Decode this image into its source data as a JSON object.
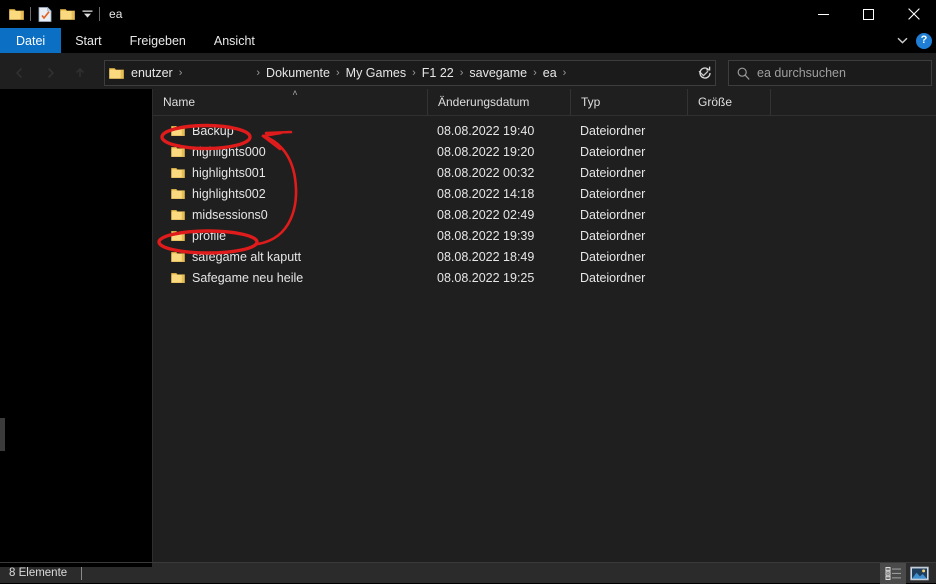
{
  "window": {
    "title": "ea",
    "quick_access": [
      {
        "icon": "folder-icon",
        "name": "quick-access-folder"
      },
      {
        "icon": "properties-icon",
        "name": "quick-access-properties"
      },
      {
        "icon": "new-folder-icon",
        "name": "quick-access-new-folder"
      }
    ],
    "controls": {
      "minimize": "minimize-icon",
      "maximize": "maximize-icon",
      "close": "close-icon"
    }
  },
  "ribbon": {
    "tabs": [
      {
        "label": "Datei",
        "active": true
      },
      {
        "label": "Start",
        "active": false
      },
      {
        "label": "Freigeben",
        "active": false
      },
      {
        "label": "Ansicht",
        "active": false
      }
    ],
    "expand_icon": "chevron-down-icon",
    "help_label": "?"
  },
  "address": {
    "breadcrumbs": [
      {
        "label": "enutzer",
        "redacted": false
      },
      {
        "label": "",
        "redacted": true
      },
      {
        "label": "Dokumente",
        "redacted": false
      },
      {
        "label": "My Games",
        "redacted": false
      },
      {
        "label": "F1 22",
        "redacted": false
      },
      {
        "label": "savegame",
        "redacted": false
      },
      {
        "label": "ea",
        "redacted": false
      }
    ],
    "separator": "›",
    "dropdown_icon": "chevron-down-icon",
    "refresh_icon": "refresh-icon"
  },
  "search": {
    "placeholder": "ea durchsuchen",
    "icon": "search-icon"
  },
  "columns": [
    {
      "key": "name",
      "label": "Name",
      "sorted": "asc"
    },
    {
      "key": "date",
      "label": "Änderungsdatum",
      "sorted": ""
    },
    {
      "key": "type",
      "label": "Typ",
      "sorted": ""
    },
    {
      "key": "size",
      "label": "Größe",
      "sorted": ""
    }
  ],
  "sort_indicator": "˄",
  "rows": [
    {
      "name": "Backup",
      "date": "08.08.2022 19:40",
      "type": "Dateiordner",
      "size": "",
      "icon": "folder-icon"
    },
    {
      "name": "highlights000",
      "date": "08.08.2022 19:20",
      "type": "Dateiordner",
      "size": "",
      "icon": "folder-icon"
    },
    {
      "name": "highlights001",
      "date": "08.08.2022 00:32",
      "type": "Dateiordner",
      "size": "",
      "icon": "folder-icon"
    },
    {
      "name": "highlights002",
      "date": "08.08.2022 14:18",
      "type": "Dateiordner",
      "size": "",
      "icon": "folder-icon"
    },
    {
      "name": "midsessions0",
      "date": "08.08.2022 02:49",
      "type": "Dateiordner",
      "size": "",
      "icon": "folder-icon"
    },
    {
      "name": "profile",
      "date": "08.08.2022 19:39",
      "type": "Dateiordner",
      "size": "",
      "icon": "folder-icon"
    },
    {
      "name": "safegame alt kaputt",
      "date": "08.08.2022 18:49",
      "type": "Dateiordner",
      "size": "",
      "icon": "folder-icon"
    },
    {
      "name": "Safegame neu heile",
      "date": "08.08.2022 19:25",
      "type": "Dateiordner",
      "size": "",
      "icon": "folder-icon"
    }
  ],
  "status": {
    "item_count": "8 Elemente",
    "view_details_icon": "details-view-icon",
    "view_large_icons_icon": "large-icons-view-icon"
  },
  "annotation": {
    "color": "#e01b1b",
    "marks": [
      {
        "type": "ellipse",
        "target": "Backup"
      },
      {
        "type": "ellipse",
        "target": "profile"
      },
      {
        "type": "arrow",
        "from": "profile",
        "to": "Backup"
      }
    ]
  },
  "colors": {
    "background": "#1f1f1f",
    "titlebar": "#000000",
    "accent": "#0b6fc4",
    "folder": "#f7d16e",
    "annotation": "#e01b1b",
    "text": "#e6e6e6"
  }
}
